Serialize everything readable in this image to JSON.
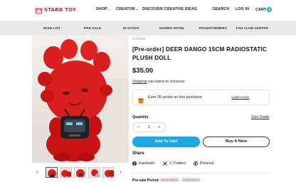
{
  "brand": {
    "name": "STARR TOY",
    "color": "#d8232a"
  },
  "nav": {
    "shop": "SHOP",
    "creator": "CREATOR",
    "discover": "DISCOVER CREATIVE IDEAS",
    "search": "SEARCH",
    "login": "LOG IN",
    "cart": "CART",
    "cart_count": "0"
  },
  "categories": [
    "WISH LIST",
    "PRE-SALE",
    "IN-STOCK",
    "HAZBIN HOTEL",
    "TRANSFORMERS",
    "FAN CLUB CENTER"
  ],
  "product": {
    "vendor": "XIYANG",
    "title": "[Pre-order] DEER DANGO 15CM RADIOSTATIC PLUSH DOLL",
    "price": "$35.00",
    "shipping_link": "Shipping",
    "shipping_rest": " calculated at checkout.",
    "points_text": "Earn 35 points on this purchase.",
    "learn_more": "Learn more",
    "quantity_label": "Quantity",
    "size_guide": "Size Guide",
    "quantity_value": "1",
    "minus": "−",
    "plus": "+",
    "add_to_cart": "Add To Cart",
    "buy_now": "Buy It Now",
    "share_label": "Share",
    "share": {
      "facebook": "Facebook",
      "twitter": "X (Twitter)",
      "pinterest": "Pinterest"
    },
    "presale_label": "Pre-sale Period:",
    "presale_period": "2026/08/03 – 2026/09/03"
  },
  "thumb_nav": {
    "prev": "‹",
    "next": "›"
  },
  "colors": {
    "accent": "#1ea7e0",
    "plush_red": "#d81e1e",
    "presale_text": "#c0392b"
  },
  "icons": [
    "brand-logo-icon",
    "chevron-down-icon",
    "gift-icon",
    "facebook-icon",
    "x-twitter-icon",
    "pinterest-icon",
    "chevron-left-icon",
    "chevron-right-icon"
  ]
}
